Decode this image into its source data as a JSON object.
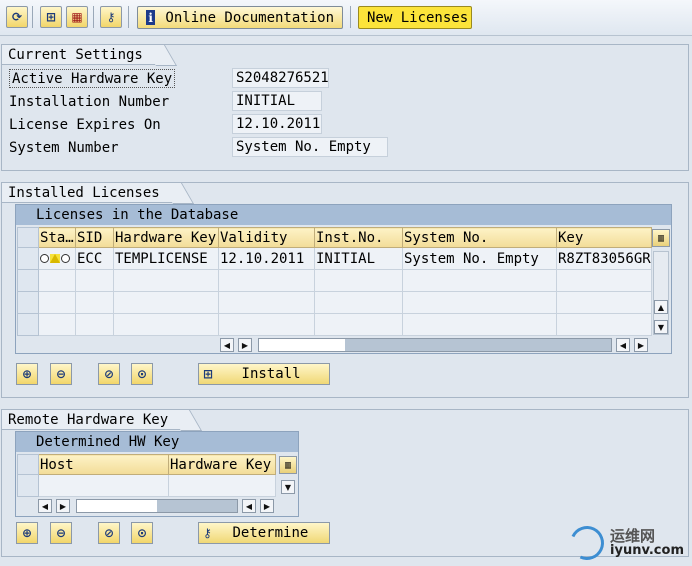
{
  "toolbar": {
    "icons": [
      "refresh-icon",
      "hierarchy-icon",
      "calendar-icon",
      "key-icon"
    ],
    "online_doc_label": "Online Documentation",
    "new_licenses_label": "New Licenses"
  },
  "current_settings": {
    "title": "Current Settings",
    "fields": [
      {
        "label": "Active Hardware Key",
        "value": "S2048276521"
      },
      {
        "label": "Installation Number",
        "value": "INITIAL"
      },
      {
        "label": "License Expires On",
        "value": "12.10.2011"
      },
      {
        "label": "System Number",
        "value": "System No. Empty"
      }
    ]
  },
  "installed_licenses": {
    "title": "Installed Licenses",
    "table_title": "Licenses in the Database",
    "columns": [
      "Sta…",
      "SID",
      "Hardware Key",
      "Validity",
      "Inst.No.",
      "System No.",
      "Key"
    ],
    "rows": [
      {
        "status": "lamps",
        "sid": "ECC",
        "hardware_key": "TEMPLICENSE",
        "validity": "12.10.2011",
        "inst_no": "INITIAL",
        "system_no": "System No. Empty",
        "key": "R8ZT83056GR"
      }
    ],
    "install_label": "Install"
  },
  "remote_hw_key": {
    "title": "Remote Hardware Key",
    "table_title": "Determined HW Key",
    "columns": [
      "Host",
      "Hardware Key"
    ],
    "determine_label": "Determine"
  },
  "watermark": {
    "brand": "运维网",
    "url": "iyunv.com"
  }
}
